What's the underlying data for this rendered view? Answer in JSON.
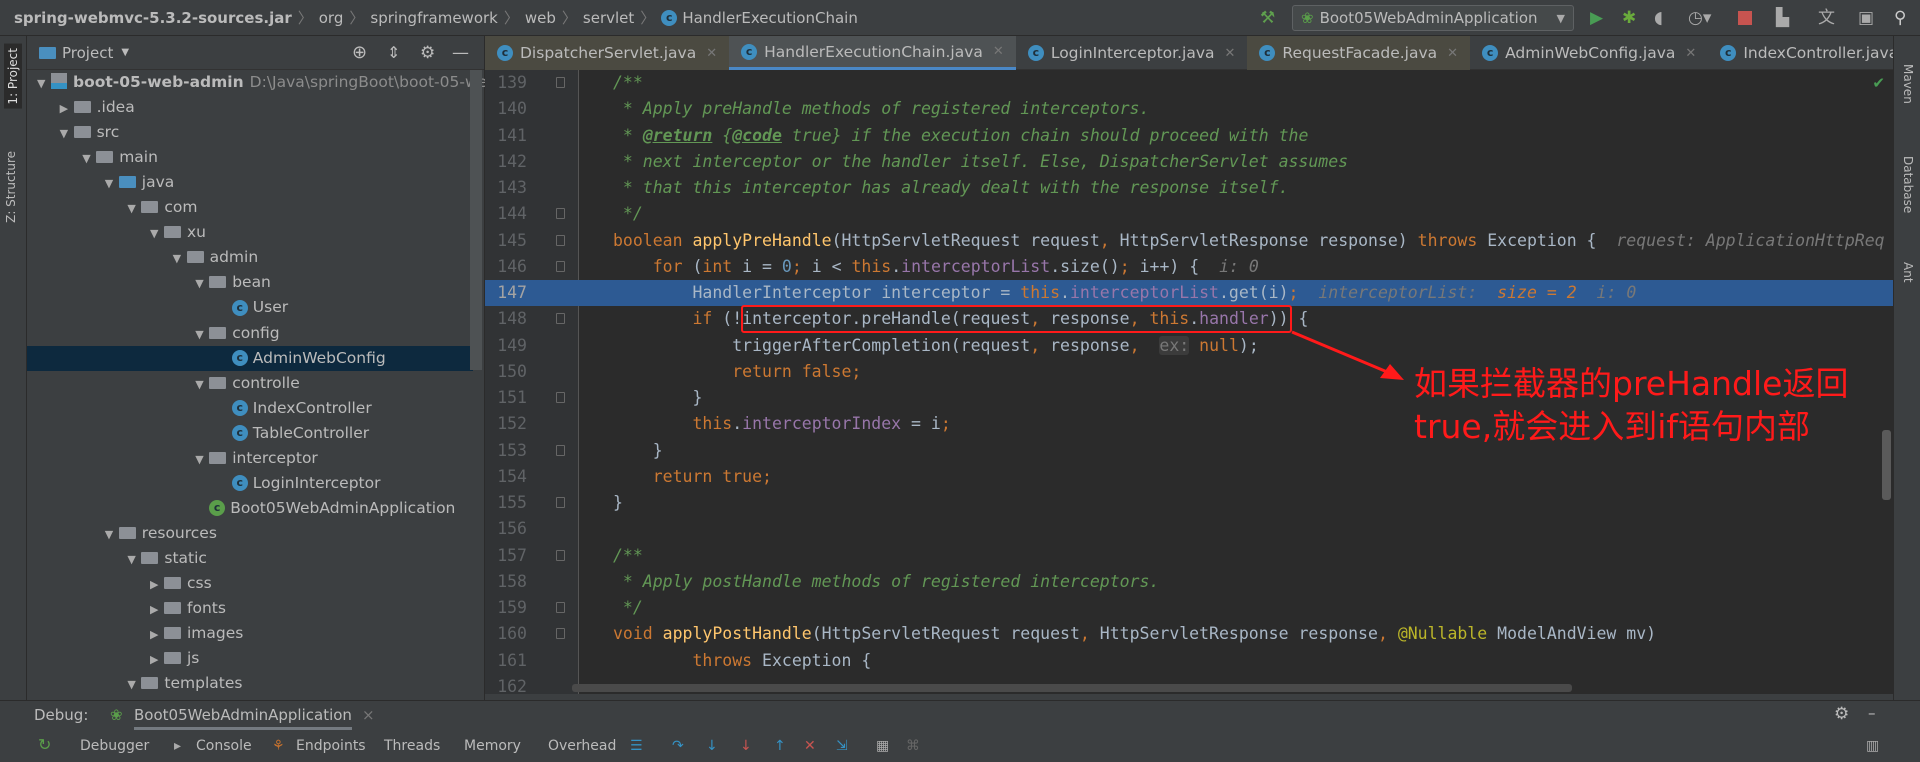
{
  "breadcrumb": [
    "spring-webmvc-5.3.2-sources.jar",
    "org",
    "springframework",
    "web",
    "servlet",
    "HandlerExecutionChain"
  ],
  "run_config": "Boot05WebAdminApplication",
  "left_strip": {
    "project": "1: Project",
    "structure": "Z: Structure"
  },
  "right_strip": {
    "maven": "Maven",
    "database": "Database",
    "ant": "Ant"
  },
  "project_panel": {
    "title": "Project",
    "tree": [
      {
        "label": "boot-05-web-admin",
        "path": "D:\\Java\\springBoot\\boot-05-web-",
        "level": 0,
        "icon": "module",
        "arrow": "down"
      },
      {
        "label": ".idea",
        "level": 1,
        "icon": "folder",
        "arrow": "right"
      },
      {
        "label": "src",
        "level": 1,
        "icon": "folder",
        "arrow": "down"
      },
      {
        "label": "main",
        "level": 2,
        "icon": "folder",
        "arrow": "down"
      },
      {
        "label": "java",
        "level": 3,
        "icon": "source-folder",
        "arrow": "down"
      },
      {
        "label": "com",
        "level": 4,
        "icon": "package",
        "arrow": "down"
      },
      {
        "label": "xu",
        "level": 5,
        "icon": "package",
        "arrow": "down"
      },
      {
        "label": "admin",
        "level": 6,
        "icon": "package",
        "arrow": "down"
      },
      {
        "label": "bean",
        "level": 7,
        "icon": "package",
        "arrow": "down"
      },
      {
        "label": "User",
        "level": 8,
        "icon": "class"
      },
      {
        "label": "config",
        "level": 7,
        "icon": "package",
        "arrow": "down"
      },
      {
        "label": "AdminWebConfig",
        "level": 8,
        "icon": "class",
        "selected": true
      },
      {
        "label": "controlle",
        "level": 7,
        "icon": "package",
        "arrow": "down"
      },
      {
        "label": "IndexController",
        "level": 8,
        "icon": "class"
      },
      {
        "label": "TableController",
        "level": 8,
        "icon": "class"
      },
      {
        "label": "interceptor",
        "level": 7,
        "icon": "package",
        "arrow": "down"
      },
      {
        "label": "LoginInterceptor",
        "level": 8,
        "icon": "class"
      },
      {
        "label": "Boot05WebAdminApplication",
        "level": 7,
        "icon": "spring-class"
      },
      {
        "label": "resources",
        "level": 3,
        "icon": "resources-folder",
        "arrow": "down"
      },
      {
        "label": "static",
        "level": 4,
        "icon": "folder",
        "arrow": "down"
      },
      {
        "label": "css",
        "level": 5,
        "icon": "folder",
        "arrow": "right"
      },
      {
        "label": "fonts",
        "level": 5,
        "icon": "folder",
        "arrow": "right"
      },
      {
        "label": "images",
        "level": 5,
        "icon": "folder",
        "arrow": "right"
      },
      {
        "label": "js",
        "level": 5,
        "icon": "folder",
        "arrow": "right"
      },
      {
        "label": "templates",
        "level": 4,
        "icon": "folder",
        "arrow": "down"
      }
    ]
  },
  "tabs": [
    {
      "label": "DispatcherServlet.java",
      "locked": true
    },
    {
      "label": "HandlerExecutionChain.java",
      "locked": true,
      "active": true
    },
    {
      "label": "LoginInterceptor.java"
    },
    {
      "label": "RequestFacade.java",
      "locked": true
    },
    {
      "label": "AdminWebConfig.java"
    },
    {
      "label": "IndexController.java"
    }
  ],
  "editor": {
    "current_line": "147",
    "lines": [
      {
        "n": "139",
        "fold": true,
        "t": [
          [
            "/**",
            "c"
          ]
        ]
      },
      {
        "n": "140",
        "t": [
          [
            " * Apply preHandle methods of registered interceptors.",
            "c"
          ]
        ]
      },
      {
        "n": "141",
        "t": [
          [
            " * ",
            "c"
          ],
          [
            "@return",
            "ct"
          ],
          [
            " {",
            "c"
          ],
          [
            "@code",
            "ct"
          ],
          [
            " true} if the execution chain should proceed with the",
            "c"
          ]
        ]
      },
      {
        "n": "142",
        "t": [
          [
            " * next interceptor or the handler itself. Else, DispatcherServlet assumes",
            "c"
          ]
        ]
      },
      {
        "n": "143",
        "t": [
          [
            " * that this interceptor has already dealt with the response itself.",
            "c"
          ]
        ]
      },
      {
        "n": "144",
        "fold": true,
        "t": [
          [
            " */",
            "c"
          ]
        ]
      },
      {
        "n": "145",
        "fold": true,
        "t": [
          [
            "boolean ",
            "k"
          ],
          [
            "applyPreHandle",
            "m"
          ],
          [
            "(HttpServletRequest request",
            "p"
          ],
          [
            ", ",
            "k"
          ],
          [
            "HttpServletResponse response) ",
            "p"
          ],
          [
            "throws ",
            "k"
          ],
          [
            "Exception {  ",
            "p"
          ],
          [
            "request: ApplicationHttpReq",
            "h"
          ]
        ]
      },
      {
        "n": "146",
        "fold": true,
        "t": [
          [
            "    for ",
            "k"
          ],
          [
            "(",
            "p"
          ],
          [
            "int ",
            "k"
          ],
          [
            "i = ",
            "p"
          ],
          [
            "0",
            "n"
          ],
          [
            "; ",
            "k"
          ],
          [
            "i < ",
            "p"
          ],
          [
            "this",
            "k"
          ],
          [
            ".",
            "p"
          ],
          [
            "interceptorList",
            "f"
          ],
          [
            ".size()",
            "p"
          ],
          [
            "; ",
            "k"
          ],
          [
            "i++) {  ",
            "p"
          ],
          [
            "i: 0",
            "h"
          ]
        ]
      },
      {
        "n": "147",
        "t": [
          [
            "        HandlerInterceptor interceptor = ",
            "p"
          ],
          [
            "this",
            "k"
          ],
          [
            ".",
            "p"
          ],
          [
            "interceptorList",
            "f"
          ],
          [
            ".get(i)",
            "p"
          ],
          [
            ";  ",
            "k"
          ],
          [
            "interceptorList:  ",
            "h"
          ],
          [
            "size = 2",
            "hn"
          ],
          [
            "  i: 0",
            "h"
          ]
        ]
      },
      {
        "n": "148",
        "fold": true,
        "t": [
          [
            "        if ",
            "k"
          ],
          [
            "(!interceptor.preHandle(request",
            "p"
          ],
          [
            ", ",
            "k"
          ],
          [
            "response",
            "p"
          ],
          [
            ", ",
            "k"
          ],
          [
            "this",
            "k"
          ],
          [
            ".",
            "p"
          ],
          [
            "handler",
            "f"
          ],
          [
            ")) {",
            "p"
          ]
        ]
      },
      {
        "n": "149",
        "t": [
          [
            "            triggerAfterCompletion(request",
            "p"
          ],
          [
            ", ",
            "k"
          ],
          [
            "response",
            "p"
          ],
          [
            ",  ",
            "k"
          ],
          [
            "ex:",
            "hb"
          ],
          [
            " null",
            "k"
          ],
          [
            ");",
            "p"
          ]
        ]
      },
      {
        "n": "150",
        "t": [
          [
            "            return false",
            "k"
          ],
          [
            ";",
            "k"
          ]
        ]
      },
      {
        "n": "151",
        "fold": true,
        "t": [
          [
            "        }",
            "p"
          ]
        ]
      },
      {
        "n": "152",
        "t": [
          [
            "        this",
            "k"
          ],
          [
            ".",
            "p"
          ],
          [
            "interceptorIndex",
            "f"
          ],
          [
            " = i",
            "p"
          ],
          [
            ";",
            "k"
          ]
        ]
      },
      {
        "n": "153",
        "fold": true,
        "t": [
          [
            "    }",
            "p"
          ]
        ]
      },
      {
        "n": "154",
        "t": [
          [
            "    return true",
            "k"
          ],
          [
            ";",
            "k"
          ]
        ]
      },
      {
        "n": "155",
        "fold": true,
        "t": [
          [
            "}",
            "p"
          ]
        ]
      },
      {
        "n": "156",
        "t": []
      },
      {
        "n": "157",
        "fold": true,
        "t": [
          [
            "/**",
            "c"
          ]
        ]
      },
      {
        "n": "158",
        "t": [
          [
            " * Apply postHandle methods of registered interceptors.",
            "c"
          ]
        ]
      },
      {
        "n": "159",
        "fold": true,
        "t": [
          [
            " */",
            "c"
          ]
        ]
      },
      {
        "n": "160",
        "fold": true,
        "t": [
          [
            "void ",
            "k"
          ],
          [
            "applyPostHandle",
            "m"
          ],
          [
            "(HttpServletRequest request",
            "p"
          ],
          [
            ", ",
            "k"
          ],
          [
            "HttpServletResponse response",
            "p"
          ],
          [
            ", ",
            "k"
          ],
          [
            "@Nullable ",
            "a"
          ],
          [
            "ModelAndView mv)",
            "p"
          ]
        ]
      },
      {
        "n": "161",
        "t": [
          [
            "        throws ",
            "k"
          ],
          [
            "Exception {",
            "p"
          ]
        ]
      },
      {
        "n": "162",
        "t": []
      }
    ]
  },
  "annotation": {
    "line1": "如果拦截器的preHandle返回",
    "line2": "true,就会进入到if语句内部",
    "color": "#ff1a1a"
  },
  "debug": {
    "label": "Debug:",
    "session": "Boot05WebAdminApplication",
    "tabs": [
      "Debugger",
      "Console",
      "Endpoints",
      "Threads",
      "Memory",
      "Overhead"
    ]
  }
}
